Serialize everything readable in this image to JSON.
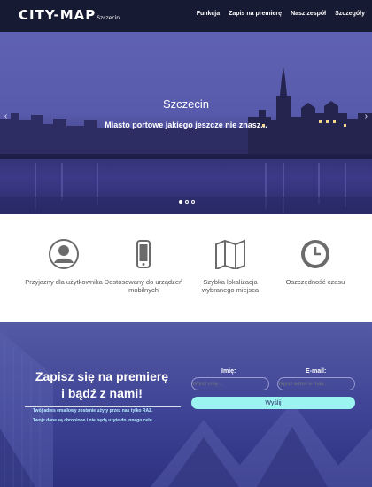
{
  "brand": {
    "name": "CITY-MAP",
    "sub": "Szczecin"
  },
  "nav": {
    "items": [
      "Funkcja",
      "Zapis na premierę",
      "Nasz zespół",
      "Szczegóły"
    ]
  },
  "hero": {
    "title": "Szczecin",
    "subtitle": "Miasto portowe jakiego jeszcze nie znasz...",
    "prev_glyph": "‹",
    "next_glyph": "›",
    "slide_count": 3,
    "active_slide": 1
  },
  "features": [
    {
      "icon": "user-icon",
      "label": "Przyjazny dla użytkownika"
    },
    {
      "icon": "mobile-icon",
      "label": "Dostosowany do urządzeń mobilnych"
    },
    {
      "icon": "map-icon",
      "label": "Szybka lokalizacja wybranego miejsca"
    },
    {
      "icon": "clock-icon",
      "label": "Oszczędność czasu"
    }
  ],
  "signup": {
    "title_line1": "Zapisz się na premierę",
    "title_line2": "i bądź z nami!",
    "note1": "Twój adres emailowy zostanie użyty przez nas tylko RAZ.",
    "note2": "Twoje dane są chronione i nie będą użyte do innego celu.",
    "name_label": "Imię:",
    "name_placeholder": "Wpisz imię...",
    "email_label": "E-mail:",
    "email_placeholder": "Wpisz adres e-mail...",
    "submit_label": "Wyślij"
  },
  "colors": {
    "nav_bg": "#161a33",
    "hero_tint": "#5355a6",
    "signup_bg": "#3f4395",
    "accent": "#9cf4f0",
    "icon_gray": "#6b6b6b"
  }
}
